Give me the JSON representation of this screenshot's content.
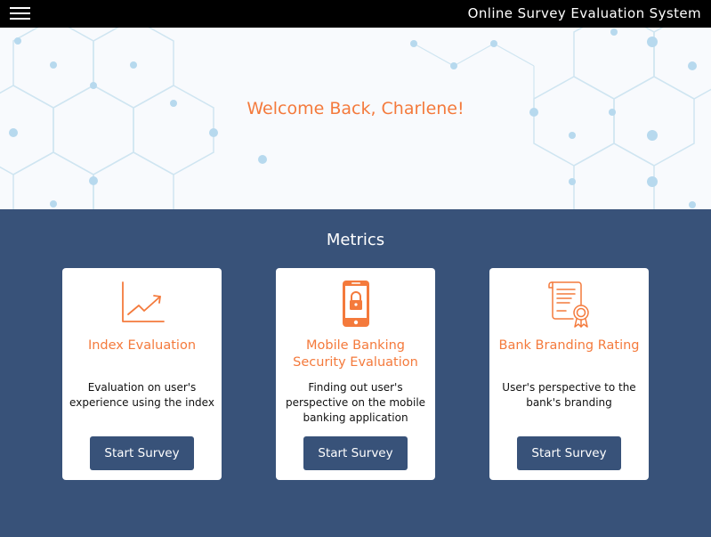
{
  "header": {
    "app_title": "Online Survey Evaluation System",
    "menu_icon": "hamburger-menu-icon"
  },
  "hero": {
    "welcome_text": "Welcome Back, Charlene!"
  },
  "metrics": {
    "title": "Metrics",
    "cards": [
      {
        "icon": "line-chart-icon",
        "title": "Index Evaluation",
        "description": "Evaluation on user's experience using the index",
        "button_label": "Start Survey"
      },
      {
        "icon": "mobile-lock-icon",
        "title": "Mobile Banking Security Evaluation",
        "description": "Finding out user's perspective on the mobile banking application",
        "button_label": "Start Survey"
      },
      {
        "icon": "certificate-icon",
        "title": "Bank Branding Rating",
        "description": "User's perspective to the bank's branding",
        "button_label": "Start Survey"
      }
    ]
  },
  "colors": {
    "accent": "#f47a3c",
    "primary": "#385279",
    "header_bg": "#000000"
  }
}
